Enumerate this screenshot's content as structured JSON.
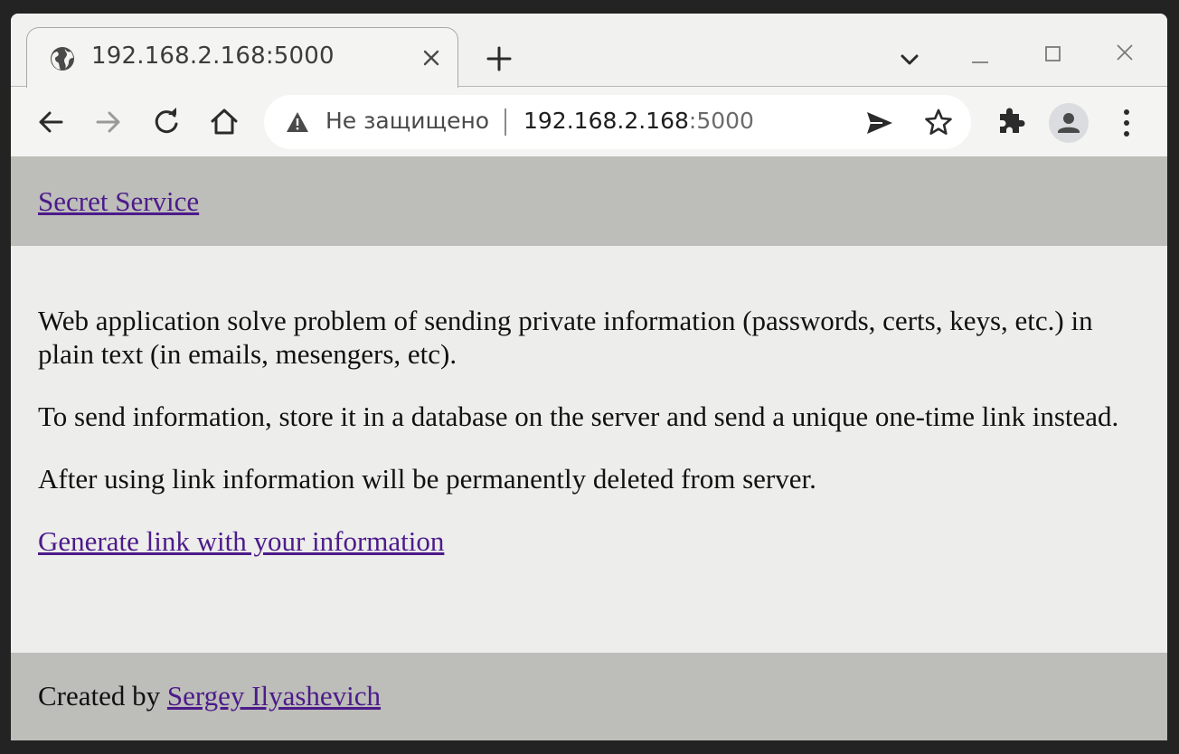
{
  "browser": {
    "tab": {
      "title": "192.168.2.168:5000",
      "favicon": "globe-icon"
    },
    "new_tab_icon": "plus-icon",
    "window_controls": [
      "chevron-down-icon",
      "minimize-icon",
      "maximize-icon",
      "close-icon"
    ],
    "toolbar": {
      "back_icon": "arrow-left-icon",
      "forward_icon": "arrow-right-icon",
      "reload_icon": "reload-icon",
      "home_icon": "home-icon"
    },
    "omnibox": {
      "security_text": "Не защищено",
      "url_host": "192.168.2.168",
      "url_port": ":5000",
      "send_icon": "send-icon",
      "bookmark_icon": "star-icon"
    },
    "extensions_icon": "puzzle-icon",
    "profile_icon": "person-icon",
    "menu_icon": "kebab-menu-icon"
  },
  "site": {
    "title": "Secret Service",
    "paragraphs": [
      "Web application solve problem of sending private information (passwords, certs, keys, etc.) in plain text (in emails, mesengers, etc).",
      "To send information, store it in a database on the server and send a unique one-time link instead.",
      "After using link information will be permanently deleted from server."
    ],
    "generate_link": "Generate link with your information",
    "footer": {
      "prefix": "Created by ",
      "author": "Sergey Ilyashevich"
    }
  },
  "colors": {
    "link": "#4c1b8a",
    "header_bg": "#bdbdb9",
    "page_bg": "#ededeb",
    "chrome_bg": "#f1f1ef"
  }
}
